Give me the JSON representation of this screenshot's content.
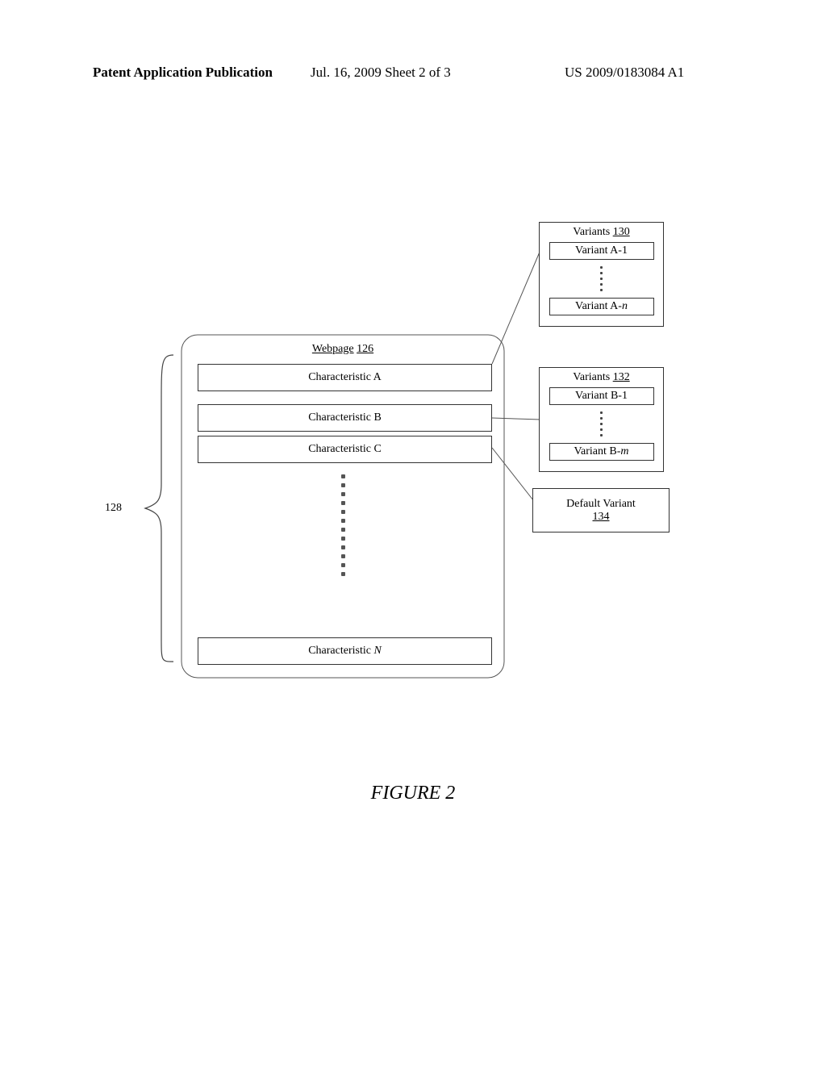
{
  "header": {
    "left": "Patent Application Publication",
    "mid": "Jul. 16, 2009  Sheet 2 of 3",
    "right": "US 2009/0183084 A1"
  },
  "figure_label": "FIGURE 2",
  "webpage": {
    "title_text": "Webpage",
    "title_ref": "126",
    "char_a": "Characteristic A",
    "char_b": "Characteristic B",
    "char_c": "Characteristic C",
    "char_n_prefix": "Characteristic ",
    "char_n_var": "N"
  },
  "brace_ref": "128",
  "variants_a": {
    "title_text": "Variants",
    "title_ref": "130",
    "first": "Variant A-1",
    "last_prefix": "Variant A-",
    "last_var": "n"
  },
  "variants_b": {
    "title_text": "Variants",
    "title_ref": "132",
    "first": "Variant B-1",
    "last_prefix": "Variant B-",
    "last_var": "m"
  },
  "default_variant": {
    "text": "Default Variant",
    "ref": "134"
  }
}
